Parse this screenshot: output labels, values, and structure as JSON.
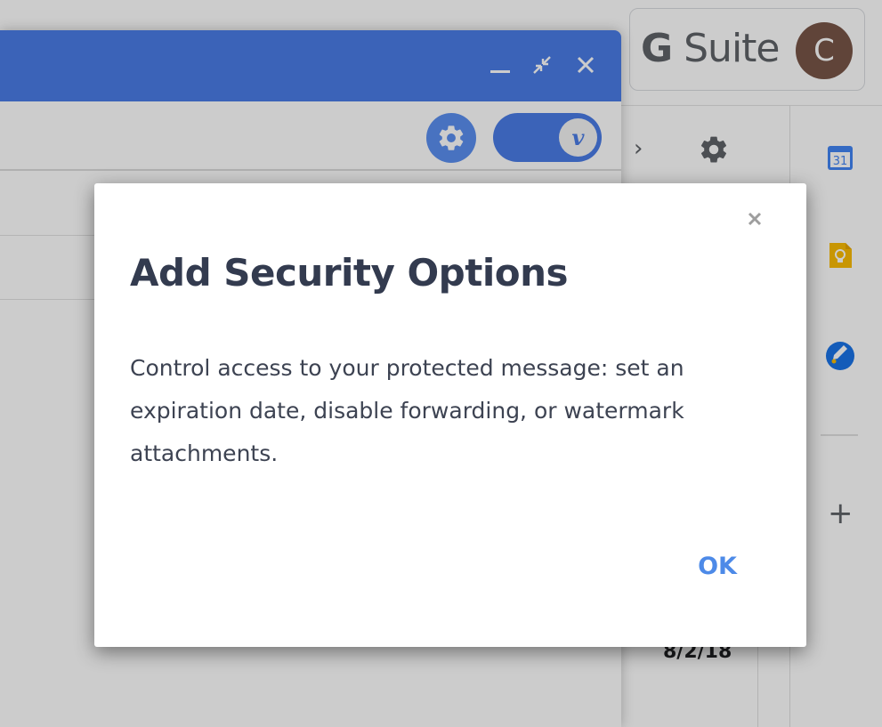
{
  "gsuite": {
    "logo_g": "G",
    "logo_suite": "Suite",
    "avatar_initial": "C"
  },
  "background": {
    "date": "8/2/18",
    "calendar_day": "31"
  },
  "compose": {
    "header_color": "#4a7ce6",
    "toggle_knob_letter": "v"
  },
  "dialog": {
    "title": "Add Security Options",
    "body": "Control access to your protected message: set an expiration date, disable forwarding, or watermark attachments.",
    "ok_label": "OK",
    "accent_color": "#4d8ae8"
  },
  "icons": {
    "dialog_close": "close-icon",
    "settings": "gear-icon",
    "compose_minimize": "minimize-icon",
    "compose_exit_fullscreen": "exit-fullscreen-icon",
    "compose_close": "close-icon",
    "sidebar": [
      "calendar-icon",
      "keep-icon",
      "tasks-icon",
      "plus-icon"
    ]
  }
}
